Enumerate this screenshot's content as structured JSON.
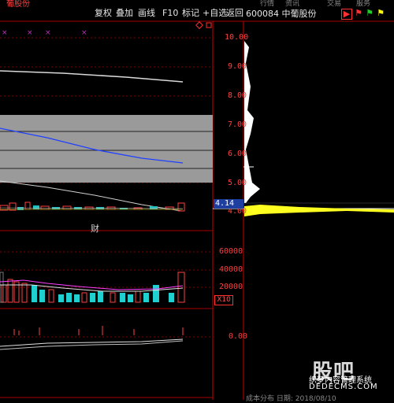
{
  "menu": {
    "items": [
      "行情",
      "资讯",
      "交易",
      "服务"
    ]
  },
  "app_title": "葡股份",
  "toolbar": {
    "buttons": [
      "复权",
      "叠加",
      "画线",
      "F10",
      "标记",
      "+自选",
      "返回"
    ]
  },
  "stock": {
    "code": "600084",
    "name": "中葡股份"
  },
  "price_axis": {
    "labels": [
      "10.00",
      "9.00",
      "8.00",
      "7.00",
      "6.00",
      "5.00",
      "4.00"
    ]
  },
  "current_price": "4.14",
  "volume_axis": {
    "labels": [
      "60000",
      "40000",
      "20000"
    ],
    "unit": "X10"
  },
  "indicator_axis": {
    "labels": [
      "0.00"
    ]
  },
  "finance_label": "财",
  "footer": {
    "text": "成本分布 日期: 2018/08/10"
  },
  "watermark": {
    "logo": "股吧",
    "line1": "织梦内容管理系统",
    "line2": "DEDECMS.COM"
  },
  "colors": {
    "accent": "#ff3030",
    "ma": "#3050ff",
    "chip": "#ffff00"
  }
}
